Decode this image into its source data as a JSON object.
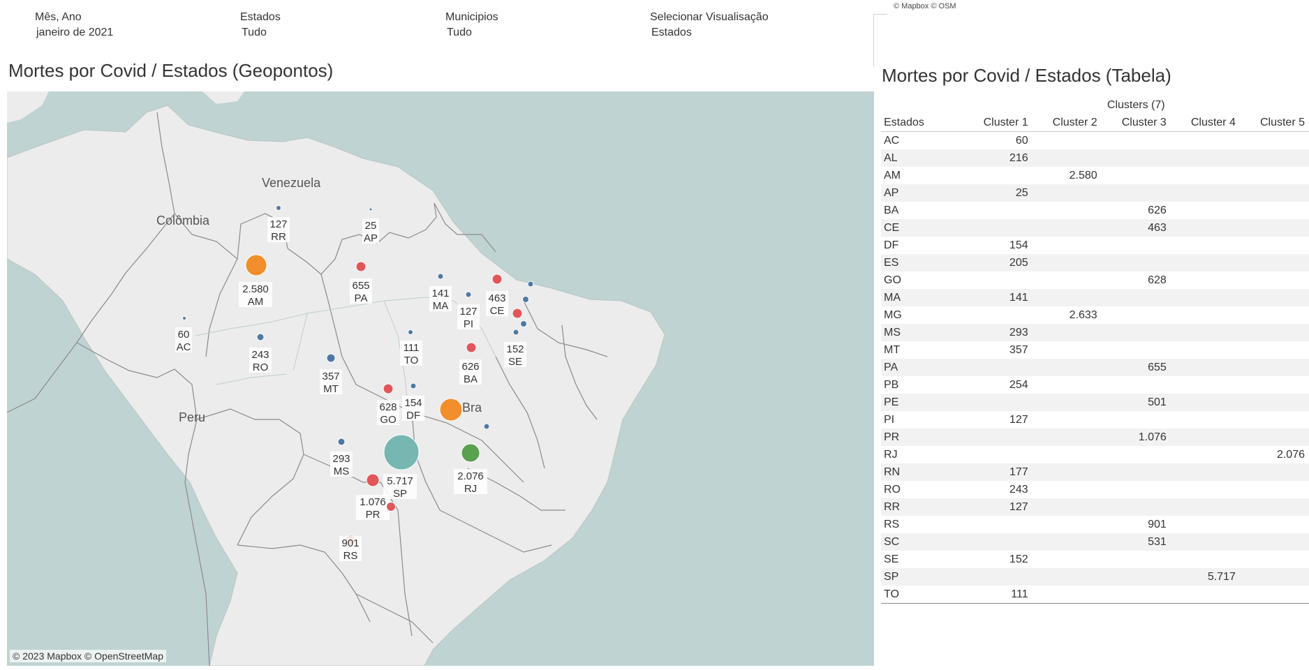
{
  "filters": [
    {
      "label": "Mês, Ano",
      "value": "janeiro de 2021"
    },
    {
      "label": "Estados",
      "value": "Tudo"
    },
    {
      "label": "Municipios",
      "value": "Tudo"
    },
    {
      "label": "Selecionar Visualisação",
      "value": "Estados"
    }
  ],
  "top_attribution": "© Mapbox © OSM",
  "map": {
    "title": "Mortes por Covid / Estados (Geopontos)",
    "attribution": "© 2023 Mapbox © OpenStreetMap",
    "country_labels": [
      "Venezuela",
      "Colômbia",
      "Peru",
      "Bra"
    ],
    "colors": {
      "water": "#c0d3d3",
      "land": "#ececec",
      "border": "#8a8a8a",
      "cluster_blue": "#4e79a7",
      "cluster_red": "#e15759",
      "cluster_orange": "#f28e2b",
      "cluster_teal": "#76b7b2",
      "cluster_green": "#59a14f"
    },
    "points": [
      {
        "state": "RR",
        "value": "127",
        "cluster": "blue"
      },
      {
        "state": "AP",
        "value": "25",
        "cluster": "blue"
      },
      {
        "state": "AM",
        "value": "2.580",
        "cluster": "orange"
      },
      {
        "state": "PA",
        "value": "655",
        "cluster": "red"
      },
      {
        "state": "MA",
        "value": "141",
        "cluster": "blue"
      },
      {
        "state": "CE",
        "value": "463",
        "cluster": "red"
      },
      {
        "state": "PI",
        "value": "127",
        "cluster": "blue"
      },
      {
        "state": "AC",
        "value": "60",
        "cluster": "blue"
      },
      {
        "state": "RO",
        "value": "243",
        "cluster": "blue"
      },
      {
        "state": "TO",
        "value": "111",
        "cluster": "blue"
      },
      {
        "state": "SE",
        "value": "152",
        "cluster": "blue"
      },
      {
        "state": "BA",
        "value": "626",
        "cluster": "red"
      },
      {
        "state": "MT",
        "value": "357",
        "cluster": "blue"
      },
      {
        "state": "GO",
        "value": "628",
        "cluster": "red"
      },
      {
        "state": "DF",
        "value": "154",
        "cluster": "blue"
      },
      {
        "state": "MS",
        "value": "293",
        "cluster": "blue"
      },
      {
        "state": "SP",
        "value": "5.717",
        "cluster": "teal"
      },
      {
        "state": "RJ",
        "value": "2.076",
        "cluster": "green"
      },
      {
        "state": "PR",
        "value": "1.076",
        "cluster": "red"
      },
      {
        "state": "RS",
        "value": "901",
        "cluster": "red"
      },
      {
        "state": "MG",
        "value": "",
        "cluster": "orange"
      },
      {
        "state": "RN",
        "value": "",
        "cluster": "blue"
      },
      {
        "state": "PB",
        "value": "",
        "cluster": "blue"
      },
      {
        "state": "PE",
        "value": "",
        "cluster": "red"
      },
      {
        "state": "AL",
        "value": "",
        "cluster": "blue"
      },
      {
        "state": "ES",
        "value": "",
        "cluster": "blue"
      },
      {
        "state": "SC",
        "value": "",
        "cluster": "red"
      }
    ]
  },
  "table": {
    "title": "Mortes por Covid / Estados (Tabela)",
    "group_header": "Clusters (7)",
    "row_header": "Estados",
    "columns": [
      "Cluster 1",
      "Cluster 2",
      "Cluster 3",
      "Cluster 4",
      "Cluster 5"
    ],
    "rows": [
      {
        "state": "AC",
        "cells": [
          "60",
          "",
          "",
          "",
          ""
        ]
      },
      {
        "state": "AL",
        "cells": [
          "216",
          "",
          "",
          "",
          ""
        ]
      },
      {
        "state": "AM",
        "cells": [
          "",
          "2.580",
          "",
          "",
          ""
        ]
      },
      {
        "state": "AP",
        "cells": [
          "25",
          "",
          "",
          "",
          ""
        ]
      },
      {
        "state": "BA",
        "cells": [
          "",
          "",
          "626",
          "",
          ""
        ]
      },
      {
        "state": "CE",
        "cells": [
          "",
          "",
          "463",
          "",
          ""
        ]
      },
      {
        "state": "DF",
        "cells": [
          "154",
          "",
          "",
          "",
          ""
        ]
      },
      {
        "state": "ES",
        "cells": [
          "205",
          "",
          "",
          "",
          ""
        ]
      },
      {
        "state": "GO",
        "cells": [
          "",
          "",
          "628",
          "",
          ""
        ]
      },
      {
        "state": "MA",
        "cells": [
          "141",
          "",
          "",
          "",
          ""
        ]
      },
      {
        "state": "MG",
        "cells": [
          "",
          "2.633",
          "",
          "",
          ""
        ]
      },
      {
        "state": "MS",
        "cells": [
          "293",
          "",
          "",
          "",
          ""
        ]
      },
      {
        "state": "MT",
        "cells": [
          "357",
          "",
          "",
          "",
          ""
        ]
      },
      {
        "state": "PA",
        "cells": [
          "",
          "",
          "655",
          "",
          ""
        ]
      },
      {
        "state": "PB",
        "cells": [
          "254",
          "",
          "",
          "",
          ""
        ]
      },
      {
        "state": "PE",
        "cells": [
          "",
          "",
          "501",
          "",
          ""
        ]
      },
      {
        "state": "PI",
        "cells": [
          "127",
          "",
          "",
          "",
          ""
        ]
      },
      {
        "state": "PR",
        "cells": [
          "",
          "",
          "1.076",
          "",
          ""
        ]
      },
      {
        "state": "RJ",
        "cells": [
          "",
          "",
          "",
          "",
          "2.076"
        ]
      },
      {
        "state": "RN",
        "cells": [
          "177",
          "",
          "",
          "",
          ""
        ]
      },
      {
        "state": "RO",
        "cells": [
          "243",
          "",
          "",
          "",
          ""
        ]
      },
      {
        "state": "RR",
        "cells": [
          "127",
          "",
          "",
          "",
          ""
        ]
      },
      {
        "state": "RS",
        "cells": [
          "",
          "",
          "901",
          "",
          ""
        ]
      },
      {
        "state": "SC",
        "cells": [
          "",
          "",
          "531",
          "",
          ""
        ]
      },
      {
        "state": "SE",
        "cells": [
          "152",
          "",
          "",
          "",
          ""
        ]
      },
      {
        "state": "SP",
        "cells": [
          "",
          "",
          "",
          "5.717",
          ""
        ]
      },
      {
        "state": "TO",
        "cells": [
          "111",
          "",
          "",
          "",
          ""
        ]
      }
    ]
  }
}
